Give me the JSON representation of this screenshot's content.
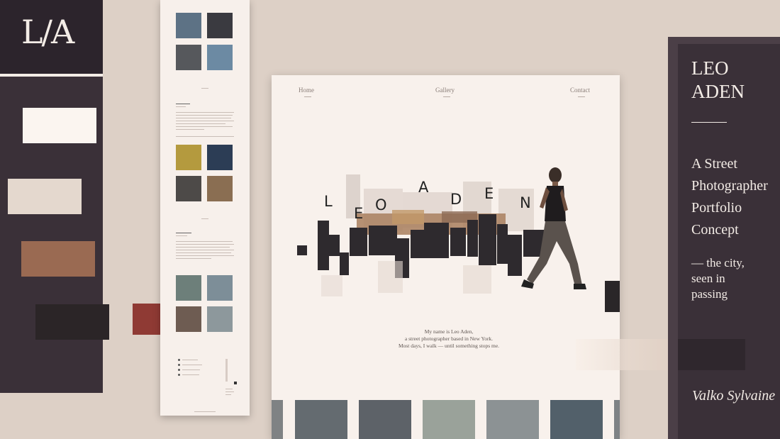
{
  "brand": {
    "logo_text": "L/A"
  },
  "palette": {
    "colors": [
      "#fbf5f0",
      "#e4d8ce",
      "#9a6a52",
      "#2b2527",
      "#8f3a34"
    ]
  },
  "desktop": {
    "nav": [
      "Home",
      "Gallery",
      "Contact"
    ],
    "hero_letters": [
      "L",
      "E",
      "O",
      "A",
      "D",
      "E",
      "N"
    ],
    "intro": [
      "My name is Leo Aden,",
      "a street photographer based in New York.",
      "Most days, I walk — until something stops me."
    ]
  },
  "sidebar": {
    "name_line1": "LEO",
    "name_line2": "ADEN",
    "tagline": [
      "A Street",
      "Photographer",
      "Portfolio",
      "Concept"
    ],
    "subtagline": [
      "— the city,",
      "seen in",
      "passing"
    ],
    "signature": "Valko Sylvaine"
  },
  "mobile": {
    "gallery_colors": [
      "#5d7285",
      "#3a3a40",
      "#56585c",
      "#6c8aa3",
      "#b49a3e",
      "#2c3d55",
      "#4d4a48",
      "#8a6e52",
      "#6d7f7a",
      "#7d8e98",
      "#6e5c52",
      "#8d989c"
    ]
  },
  "gallery_strip_colors": [
    "#7f8284",
    "#646b70",
    "#5d6268",
    "#9aa29a",
    "#8c9294",
    "#52606a"
  ]
}
